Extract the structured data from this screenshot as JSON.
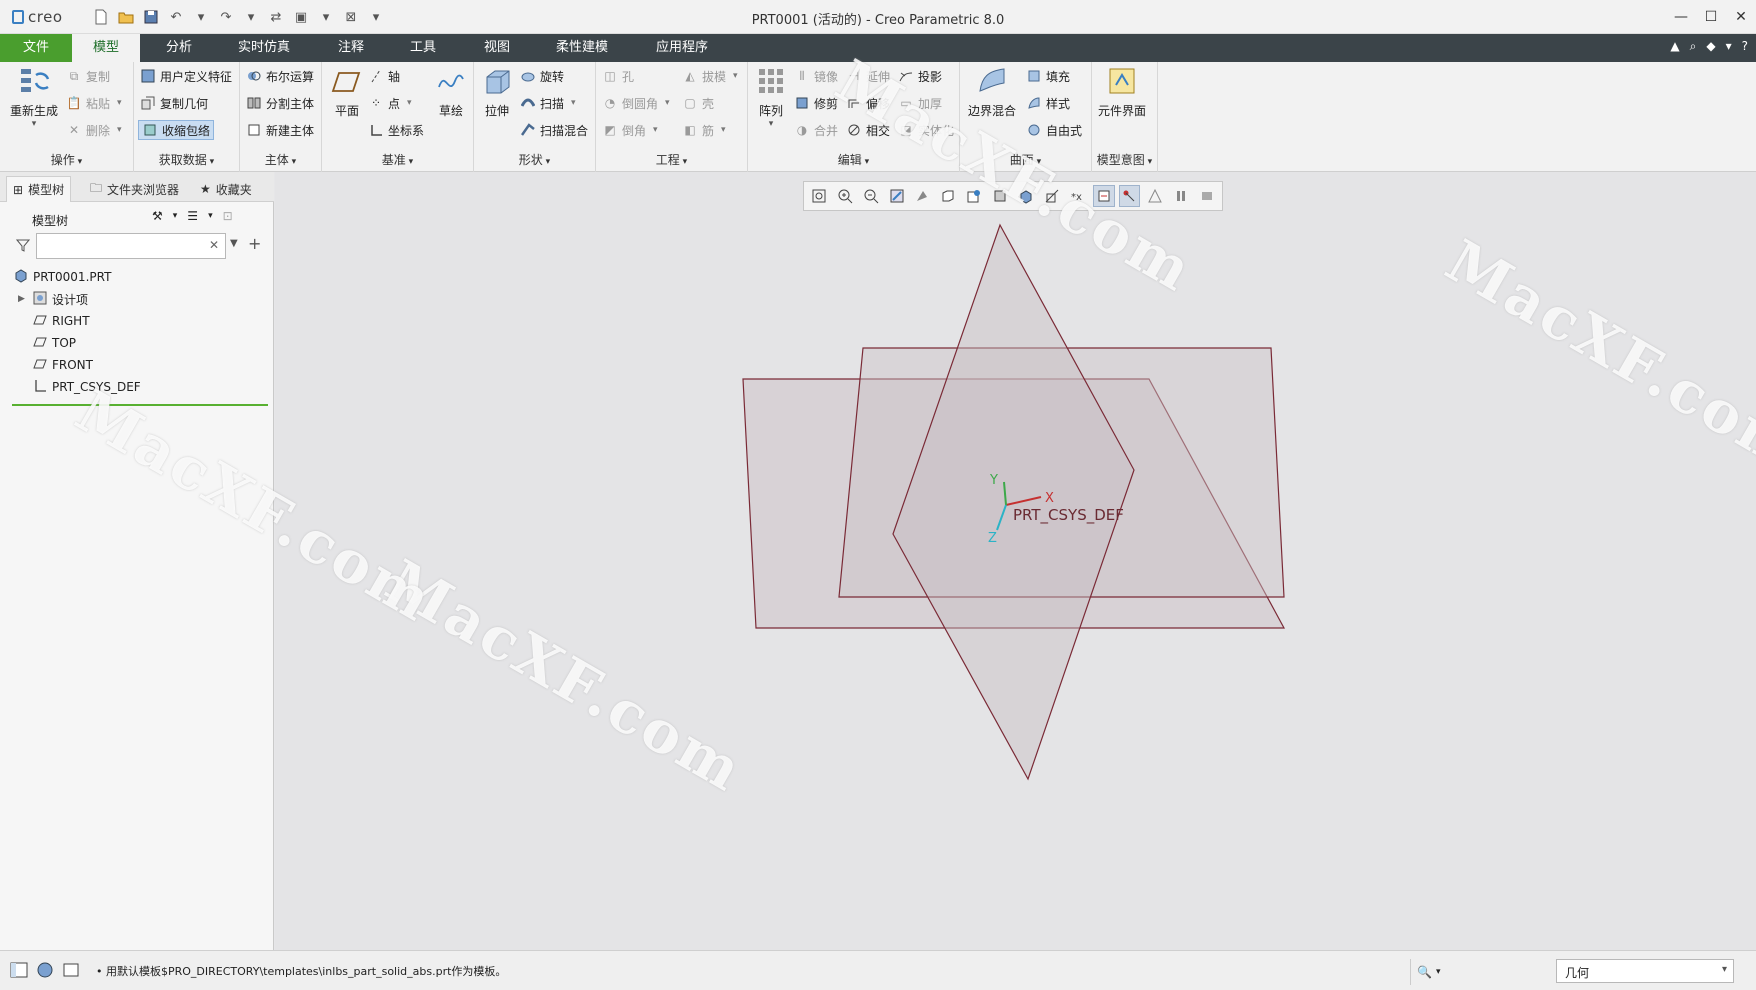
{
  "app": {
    "logo_text": "creo",
    "window_title": "PRT0001 (活动的) - Creo Parametric 8.0",
    "window_controls": [
      "minimize-icon",
      "maximize-icon",
      "close-icon"
    ]
  },
  "tabs": [
    {
      "label": "文件",
      "state": "file"
    },
    {
      "label": "模型",
      "state": "active"
    },
    {
      "label": "分析",
      "state": ""
    },
    {
      "label": "实时仿真",
      "state": ""
    },
    {
      "label": "注释",
      "state": ""
    },
    {
      "label": "工具",
      "state": ""
    },
    {
      "label": "视图",
      "state": ""
    },
    {
      "label": "柔性建模",
      "state": ""
    },
    {
      "label": "应用程序",
      "state": ""
    }
  ],
  "ribbon": {
    "operations": {
      "group": "操作",
      "regenerate": "重新生成",
      "copy": "复制",
      "paste": "粘贴",
      "delete": "删除"
    },
    "get_data": {
      "group": "获取数据",
      "udf": "用户定义特征",
      "copy_geom": "复制几何",
      "shrinkwrap": "收缩包络"
    },
    "body": {
      "group": "主体",
      "boolean": "布尔运算",
      "split": "分割主体",
      "new_body": "新建主体"
    },
    "datum": {
      "group": "基准",
      "plane": "平面",
      "axis": "轴",
      "point": "点",
      "csys": "坐标系",
      "sketch": "草绘"
    },
    "shapes": {
      "group": "形状",
      "extrude": "拉伸",
      "revolve": "旋转",
      "sweep": "扫描",
      "swept_blend": "扫描混合"
    },
    "engineering": {
      "group": "工程",
      "hole": "孔",
      "draft": "拔模",
      "round": "倒圆角",
      "shell": "壳",
      "chamfer": "倒角",
      "rib": "筋"
    },
    "editing": {
      "group": "编辑",
      "pattern": "阵列",
      "mirror": "镜像",
      "extend": "延伸",
      "project": "投影",
      "trim": "修剪",
      "offset": "偏移",
      "thicken": "加厚",
      "merge": "合并",
      "intersect": "相交",
      "solidify": "实体化"
    },
    "surfaces": {
      "group": "曲面",
      "boundary_blend": "边界混合",
      "fill": "填充",
      "style": "样式",
      "freestyle": "自由式"
    },
    "model_intent": {
      "group": "模型意图",
      "component_interface": "元件界面"
    }
  },
  "left_panel": {
    "tabs": [
      "模型树",
      "文件夹浏览器",
      "收藏夹"
    ],
    "tree_title": "模型树",
    "search_value": "",
    "tree": [
      {
        "label": "PRT0001.PRT",
        "icon": "part-icon",
        "expander": ""
      },
      {
        "label": "设计项",
        "icon": "design-items-icon",
        "expander": "▶"
      },
      {
        "label": "RIGHT",
        "icon": "datum-plane-icon",
        "expander": ""
      },
      {
        "label": "TOP",
        "icon": "datum-plane-icon",
        "expander": ""
      },
      {
        "label": "FRONT",
        "icon": "datum-plane-icon",
        "expander": ""
      },
      {
        "label": "PRT_CSYS_DEF",
        "icon": "csys-icon",
        "expander": ""
      }
    ]
  },
  "graphics": {
    "csys_label": "PRT_CSYS_DEF",
    "axis_x": "X",
    "axis_y": "Y",
    "axis_z": "Z",
    "plane_edge_color": "#7a2a36",
    "watermark": "MacXF.com"
  },
  "status": {
    "message": "• 用默认模板$PRO_DIRECTORY\\templates\\inlbs_part_solid_abs.prt作为模板。",
    "filter_value": "几何"
  }
}
